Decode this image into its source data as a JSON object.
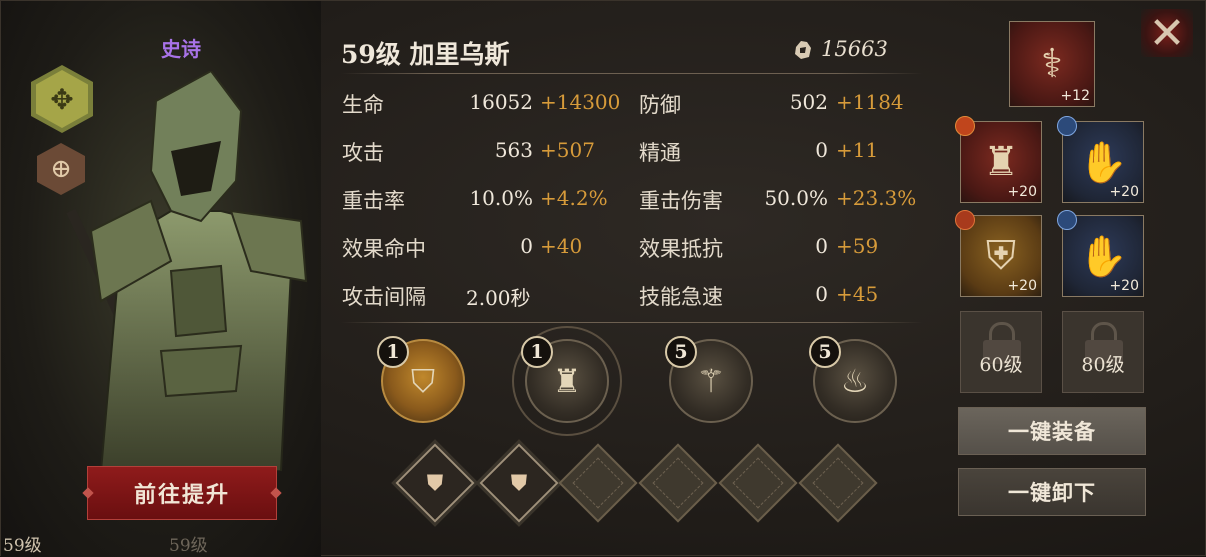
{
  "hero": {
    "rarity": "史诗",
    "name": "59级  加里乌斯",
    "power": "15663"
  },
  "upgrade_button": "前往提升",
  "footer": {
    "level_left": "59级",
    "level_right": "59级"
  },
  "stats": [
    {
      "label": "生命",
      "base": "16052",
      "bonus": "+14300"
    },
    {
      "label": "防御",
      "base": "502",
      "bonus": "+1184"
    },
    {
      "label": "攻击",
      "base": "563",
      "bonus": "+507"
    },
    {
      "label": "精通",
      "base": "0",
      "bonus": "+11"
    },
    {
      "label": "重击率",
      "base": "10.0%",
      "bonus": "+4.2%"
    },
    {
      "label": "重击伤害",
      "base": "50.0%",
      "bonus": "+23.3%"
    },
    {
      "label": "效果命中",
      "base": "0",
      "bonus": "+40"
    },
    {
      "label": "效果抵抗",
      "base": "0",
      "bonus": "+59"
    },
    {
      "label": "攻击间隔",
      "base": "2.00秒",
      "bonus": ""
    },
    {
      "label": "技能急速",
      "base": "0",
      "bonus": "+45"
    }
  ],
  "skills": [
    {
      "level": "1",
      "icon": "shield-icon"
    },
    {
      "level": "1",
      "icon": "helmet-icon"
    },
    {
      "level": "5",
      "icon": "spear-icon"
    },
    {
      "level": "5",
      "icon": "flame-icon"
    }
  ],
  "runes": [
    {
      "state": "filled",
      "icon": "shield-rune-icon"
    },
    {
      "state": "filled",
      "icon": "shield-rune-icon"
    },
    {
      "state": "empty"
    },
    {
      "state": "empty"
    },
    {
      "state": "empty"
    },
    {
      "state": "empty"
    }
  ],
  "equipment": {
    "weapon": {
      "plus": "+12",
      "icon": "staff-icon"
    },
    "helmet": {
      "plus": "+20",
      "icon": "helmet-icon"
    },
    "gauntlet_top": {
      "plus": "+20",
      "icon": "gauntlet-icon"
    },
    "armor": {
      "plus": "+20",
      "icon": "armor-icon"
    },
    "gauntlet_bottom": {
      "plus": "+20",
      "icon": "gauntlet-icon"
    },
    "lock_60": "60级",
    "lock_80": "80级"
  },
  "buttons": {
    "equip_all": "一键装备",
    "unequip_all": "一键卸下"
  },
  "colors": {
    "bonus": "#d79b3a",
    "rarity_epic": "#a873e8",
    "upgrade_red": "#8f1b1b"
  }
}
